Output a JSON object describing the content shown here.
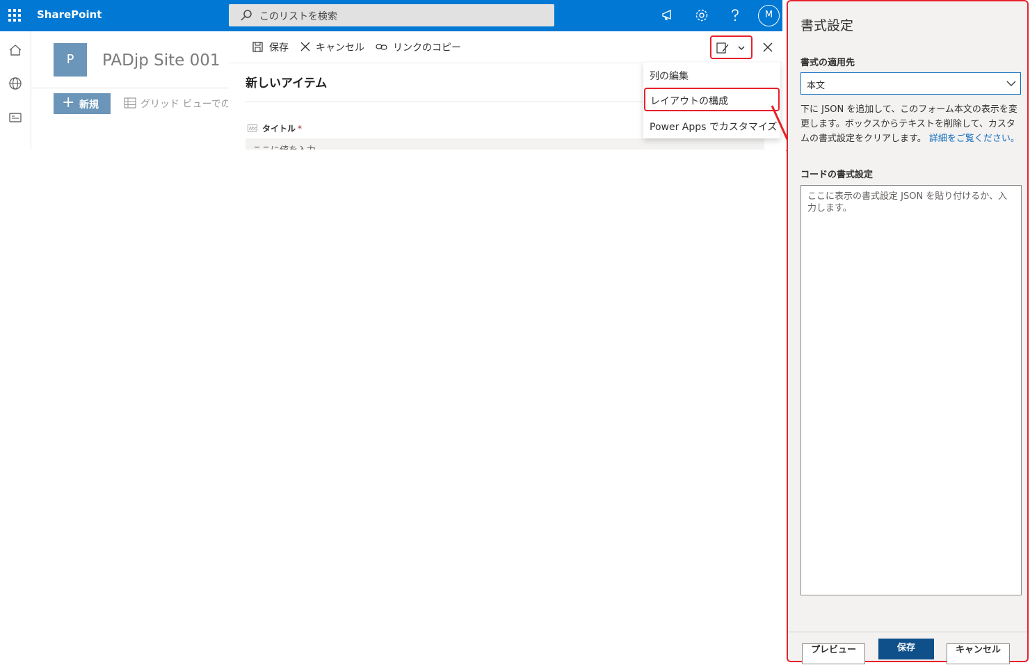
{
  "suitebar": {
    "brand": "SharePoint",
    "search_placeholder": "このリストを検索",
    "avatar_initial": "M"
  },
  "site": {
    "logo_letter": "P",
    "title": "PADjp Site 001",
    "new_button": "新規",
    "grid_view": "グリッド ビューでの編集"
  },
  "form": {
    "toolbar": {
      "save": "保存",
      "cancel": "キャンセル",
      "copy_link": "リンクのコピー"
    },
    "title": "新しいアイテム",
    "field": {
      "label": "タイトル",
      "required_mark": "*",
      "placeholder": "ここに値を入力"
    },
    "menu": [
      {
        "label": "列の編集"
      },
      {
        "label": "レイアウトの構成"
      },
      {
        "label": "Power Apps でカスタマイズ"
      }
    ]
  },
  "pane": {
    "title": "書式設定",
    "apply_to_label": "書式の適用先",
    "apply_to_value": "本文",
    "description": "下に JSON を追加して、このフォーム本文の表示を変更します。ボックスからテキストを削除して、カスタムの書式設定をクリアします。",
    "learn_more": "詳細をご覧ください。",
    "code_label": "コードの書式設定",
    "code_placeholder": "ここに表示の書式設定 JSON を貼り付けるか、入力します。",
    "buttons": {
      "preview": "プレビュー",
      "save": "保存",
      "cancel": "キャンセル"
    }
  },
  "colors": {
    "suite_blue": "#0078d4",
    "highlight_red": "#e8202a",
    "primary_button": "#0f4f8a"
  }
}
